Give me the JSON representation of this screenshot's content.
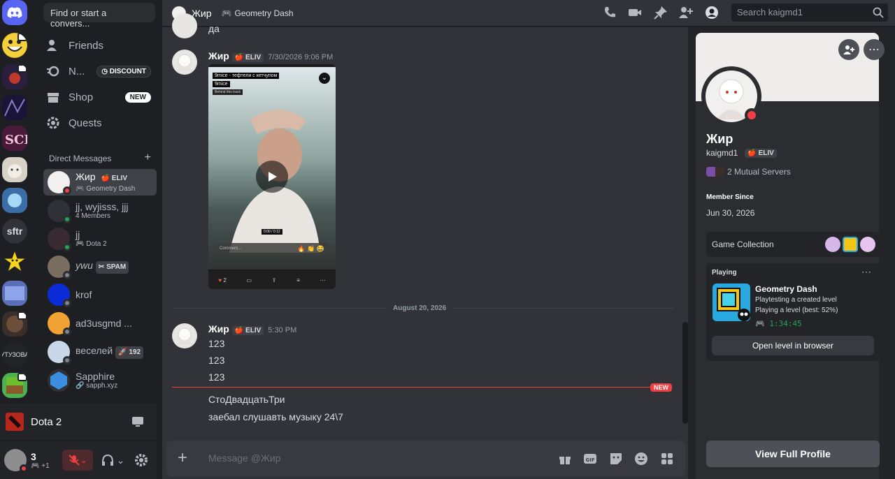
{
  "sidebar": {
    "search_placeholder": "Find or start a convers...",
    "nav": {
      "friends": "Friends",
      "nitro": "N...",
      "discount": "DISCOUNT",
      "shop": "Shop",
      "new_badge": "NEW",
      "quests": "Quests"
    },
    "dm_header": "Direct Messages",
    "dms": [
      {
        "name": "Жир",
        "tag": "ELIV",
        "sub": "Geometry Dash",
        "status": "#f23f43"
      },
      {
        "name": "jj, wyjisss, jjj",
        "sub": "4 Members"
      },
      {
        "name": "jj",
        "sub": "Dota 2",
        "status": "#23a55a"
      },
      {
        "name": "ywu",
        "tag": "SPAM",
        "status": "#80848e"
      },
      {
        "name": "krof",
        "status": "#80848e"
      },
      {
        "name": "ad3usgmd ...",
        "status": "#80848e"
      },
      {
        "name": "веселей",
        "tag": "192",
        "status": "#80848e"
      },
      {
        "name": "Sapphire",
        "sub": "sapph.xyz"
      }
    ],
    "guild_labels": {
      "sftr": "sftr",
      "utuzova": "УТУЗОВА"
    },
    "activity_game": "Dota 2",
    "user": {
      "name": "3",
      "sub": "+1"
    }
  },
  "header": {
    "title": "Жир",
    "game": "Geometry Dash",
    "search_placeholder": "Search kaigmd1"
  },
  "chat": {
    "top_snippet": "да",
    "msg1": {
      "author": "Жир",
      "tag": "ELIV",
      "time": "7/30/2026 9:06 PM",
      "video": {
        "caption1": "9mice - тефтели с кетчупом",
        "caption2": "9mice",
        "caption3": "Behind this track",
        "timecode": "0:00 / 0:12",
        "comment_placeholder": "Comment...",
        "likes": "2"
      }
    },
    "date_divider": "August 20, 2026",
    "msg2": {
      "author": "Жир",
      "tag": "ELIV",
      "time": "5:30 PM",
      "lines": [
        "123",
        "123",
        "123"
      ]
    },
    "new_label": "NEW",
    "msg3_lines": [
      "СтоДвадцатьТри",
      "заебал слушавть музыку 24\\7"
    ],
    "composer_placeholder": "Message @Жир"
  },
  "profile": {
    "display_name": "Жир",
    "username": "kaigmd1",
    "tag": "ELIV",
    "mutual": "2 Mutual Servers",
    "member_since_label": "Member Since",
    "member_since": "Jun 30, 2026",
    "game_collection": "Game Collection",
    "playing_label": "Playing",
    "game_title": "Geometry Dash",
    "game_detail1": "Playtesting a created level",
    "game_detail2": "Playing a level (best: 52%)",
    "game_elapsed": "1:34:45",
    "open_level": "Open level in browser",
    "view_full": "View Full Profile"
  }
}
